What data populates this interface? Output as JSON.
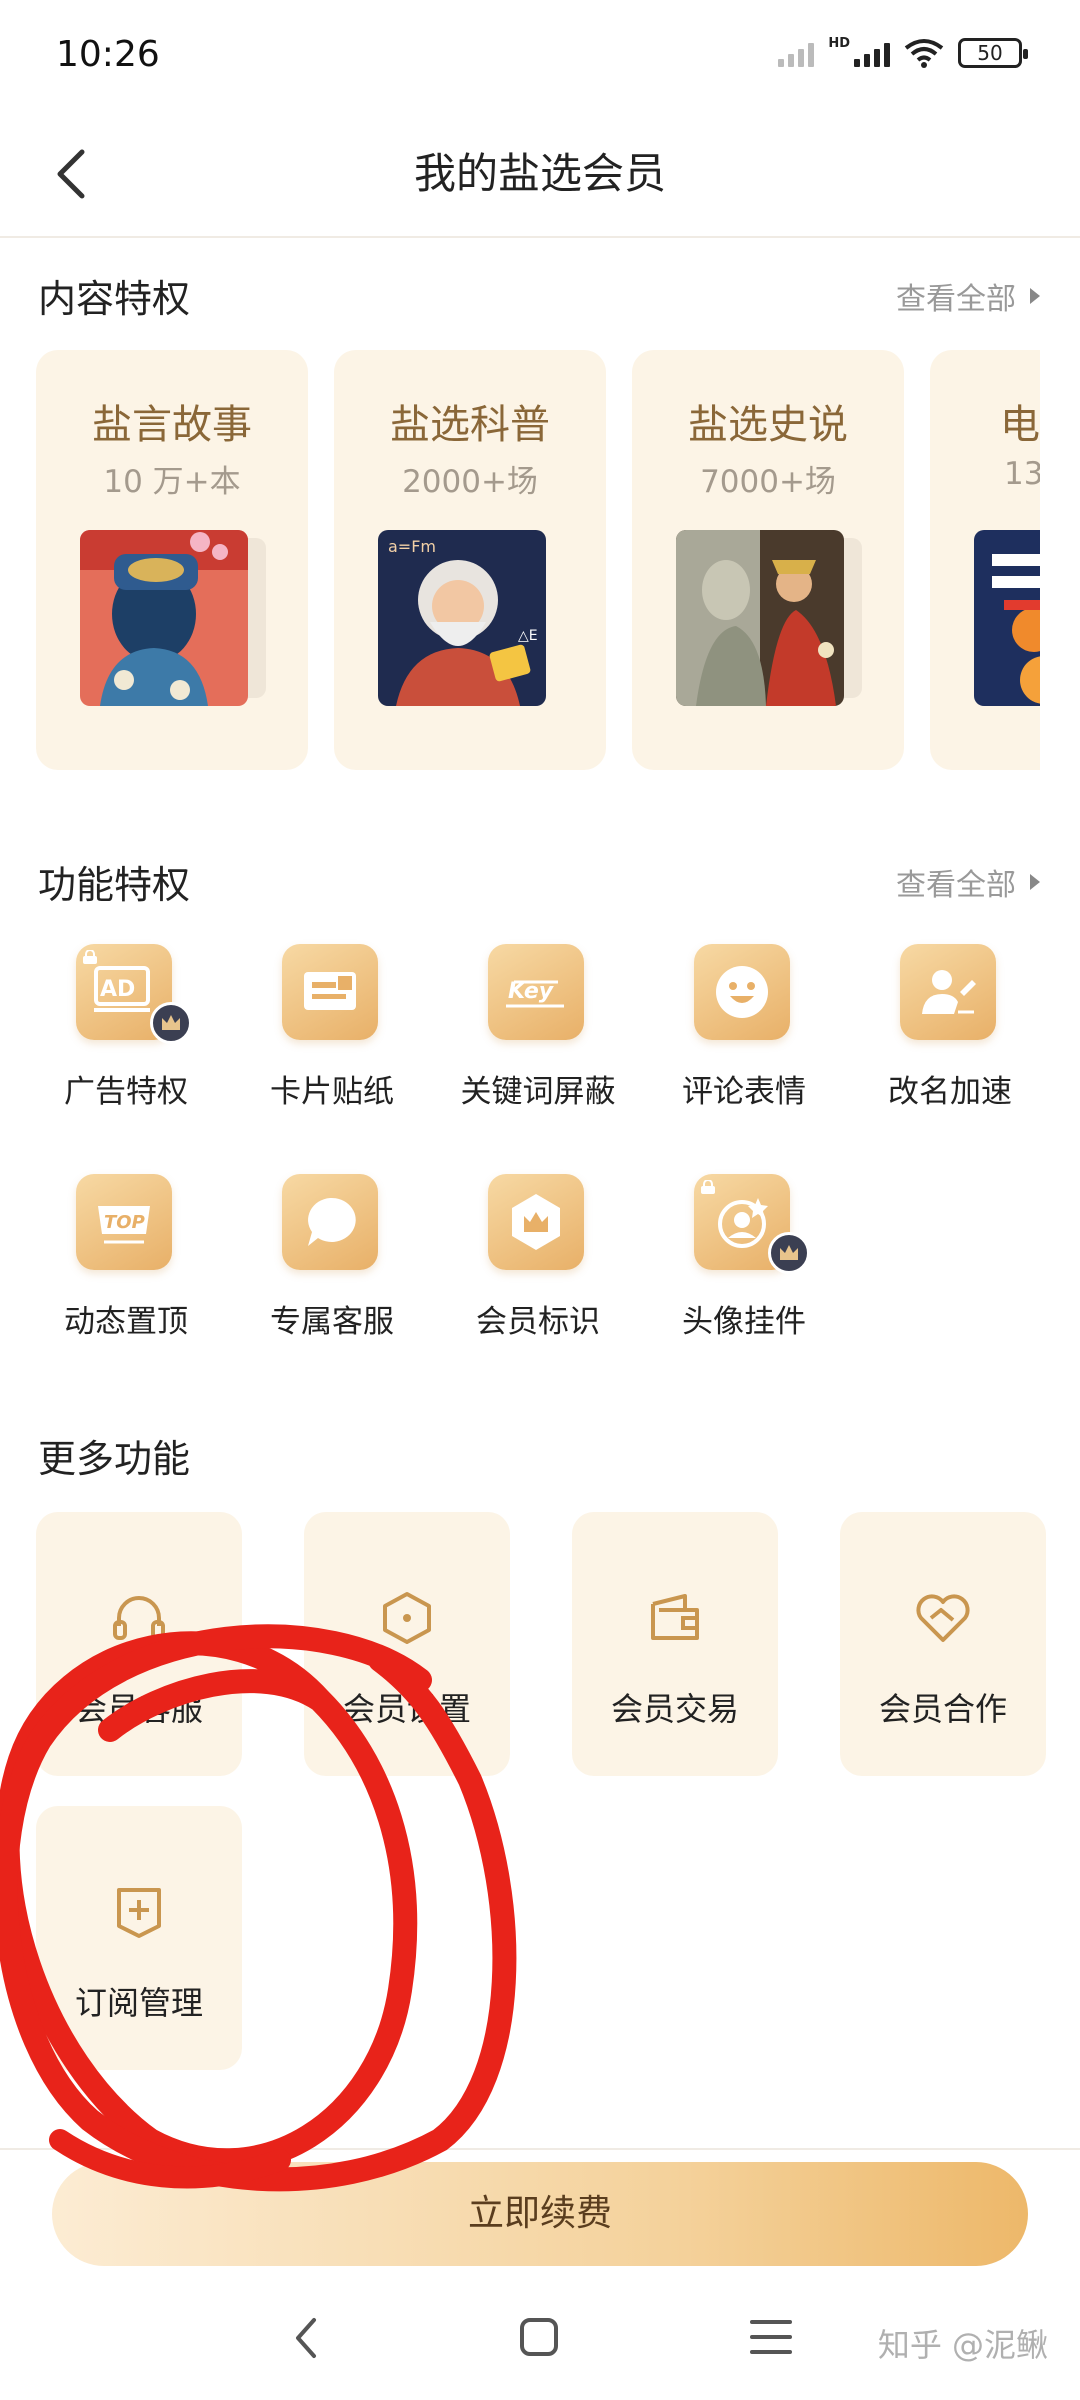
{
  "status_bar": {
    "time": "10:26",
    "network": "HD",
    "battery": "50"
  },
  "header": {
    "title": "我的盐选会员"
  },
  "content_privileges": {
    "title": "内容特权",
    "see_all": "查看全部",
    "cards": [
      {
        "title": "盐言故事",
        "subtitle": "10 万+本"
      },
      {
        "title": "盐选科普",
        "subtitle": "2000+场"
      },
      {
        "title": "盐选史说",
        "subtitle": "7000+场"
      },
      {
        "title": "电",
        "subtitle": "13"
      }
    ]
  },
  "function_privileges": {
    "title": "功能特权",
    "see_all": "查看全部",
    "items": [
      {
        "label": "广告特权",
        "icon": "ad-icon"
      },
      {
        "label": "卡片贴纸",
        "icon": "card-sticker-icon"
      },
      {
        "label": "关键词屏蔽",
        "icon": "keyword-block-icon"
      },
      {
        "label": "评论表情",
        "icon": "emoji-icon"
      },
      {
        "label": "改名加速",
        "icon": "rename-icon"
      },
      {
        "label": "动态置顶",
        "icon": "top-icon"
      },
      {
        "label": "专属客服",
        "icon": "chat-bubble-icon"
      },
      {
        "label": "会员标识",
        "icon": "member-badge-icon"
      },
      {
        "label": "头像挂件",
        "icon": "avatar-pendant-icon"
      }
    ]
  },
  "more_functions": {
    "title": "更多功能",
    "items": [
      {
        "label": "会员客服",
        "icon": "headset-icon"
      },
      {
        "label": "会员设置",
        "icon": "hexagon-settings-icon"
      },
      {
        "label": "会员交易",
        "icon": "wallet-icon"
      },
      {
        "label": "会员合作",
        "icon": "handshake-heart-icon"
      },
      {
        "label": "订阅管理",
        "icon": "subscription-add-icon"
      }
    ]
  },
  "renew_button": {
    "label": "立即续费"
  },
  "watermark": "知乎 @泥鳅",
  "colors": {
    "accent": "#e8b068",
    "card_bg": "#fcf4e6",
    "card_title": "#8a6738",
    "annotation": "#e8231a"
  }
}
